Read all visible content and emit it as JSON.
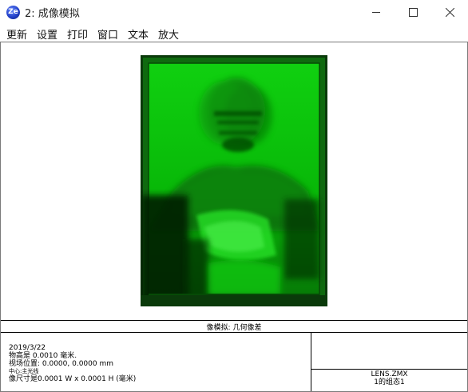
{
  "window": {
    "title": "2: 成像模拟",
    "app_icon_text": "Ze"
  },
  "menu": {
    "items": [
      "更新",
      "设置",
      "打印",
      "窗口",
      "文本",
      "放大"
    ]
  },
  "plot": {
    "caption": "像模拟: 几何像差"
  },
  "info": {
    "date": "2019/3/22",
    "object_height": "物高是 0.0010 毫米.",
    "field_position": "视场位置: 0.0000, 0.0000 mm",
    "center_note": "中心:主光线",
    "image_size": "像尺寸是0.0001 W x 0.0001 H (毫米)"
  },
  "lens": {
    "file": "LENS.ZMX",
    "config": "1的组态1"
  },
  "colors": {
    "image_green": "#00c800",
    "image_dark": "#0a3a0a"
  }
}
